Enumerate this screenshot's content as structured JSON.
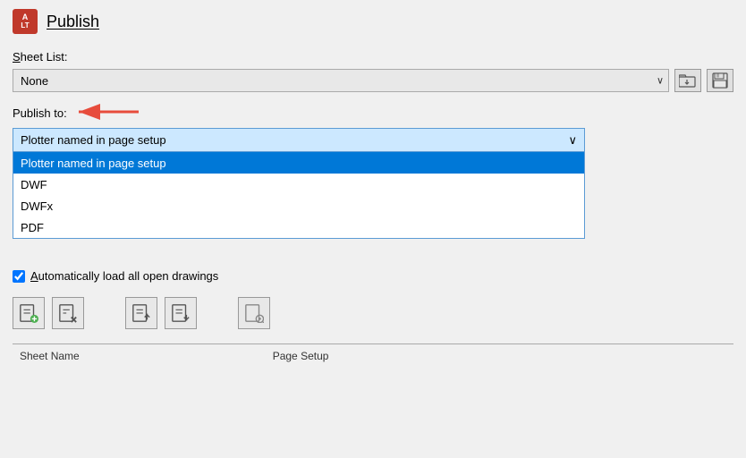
{
  "dialog": {
    "title": "Publish",
    "icon_label": "A LT"
  },
  "sheet_list": {
    "label": "Sheet List:",
    "label_underline_char": "S",
    "value": "None",
    "options": [
      "None"
    ]
  },
  "publish_to": {
    "label": "Publish to:",
    "label_underline_char": "P",
    "selected_value": "Plotter named in page setup",
    "options": [
      "Plotter named in page setup",
      "DWF",
      "DWFx",
      "PDF"
    ]
  },
  "auto_load": {
    "label": "Automatically load all open drawings",
    "label_underline_char": "A",
    "checked": true
  },
  "toolbar": {
    "buttons": [
      {
        "name": "add-sheet-button",
        "tooltip": "Add Sheets"
      },
      {
        "name": "remove-sheet-button",
        "tooltip": "Remove Sheets"
      },
      {
        "name": "move-up-button",
        "tooltip": "Move Sheet Up"
      },
      {
        "name": "move-down-button",
        "tooltip": "Move Sheet Down"
      },
      {
        "name": "preview-button",
        "tooltip": "Preview"
      }
    ]
  },
  "table": {
    "columns": [
      "Sheet Name",
      "Page Setup"
    ]
  },
  "icons": {
    "folder_open": "📂",
    "save": "💾",
    "chevron_down": "∨"
  }
}
